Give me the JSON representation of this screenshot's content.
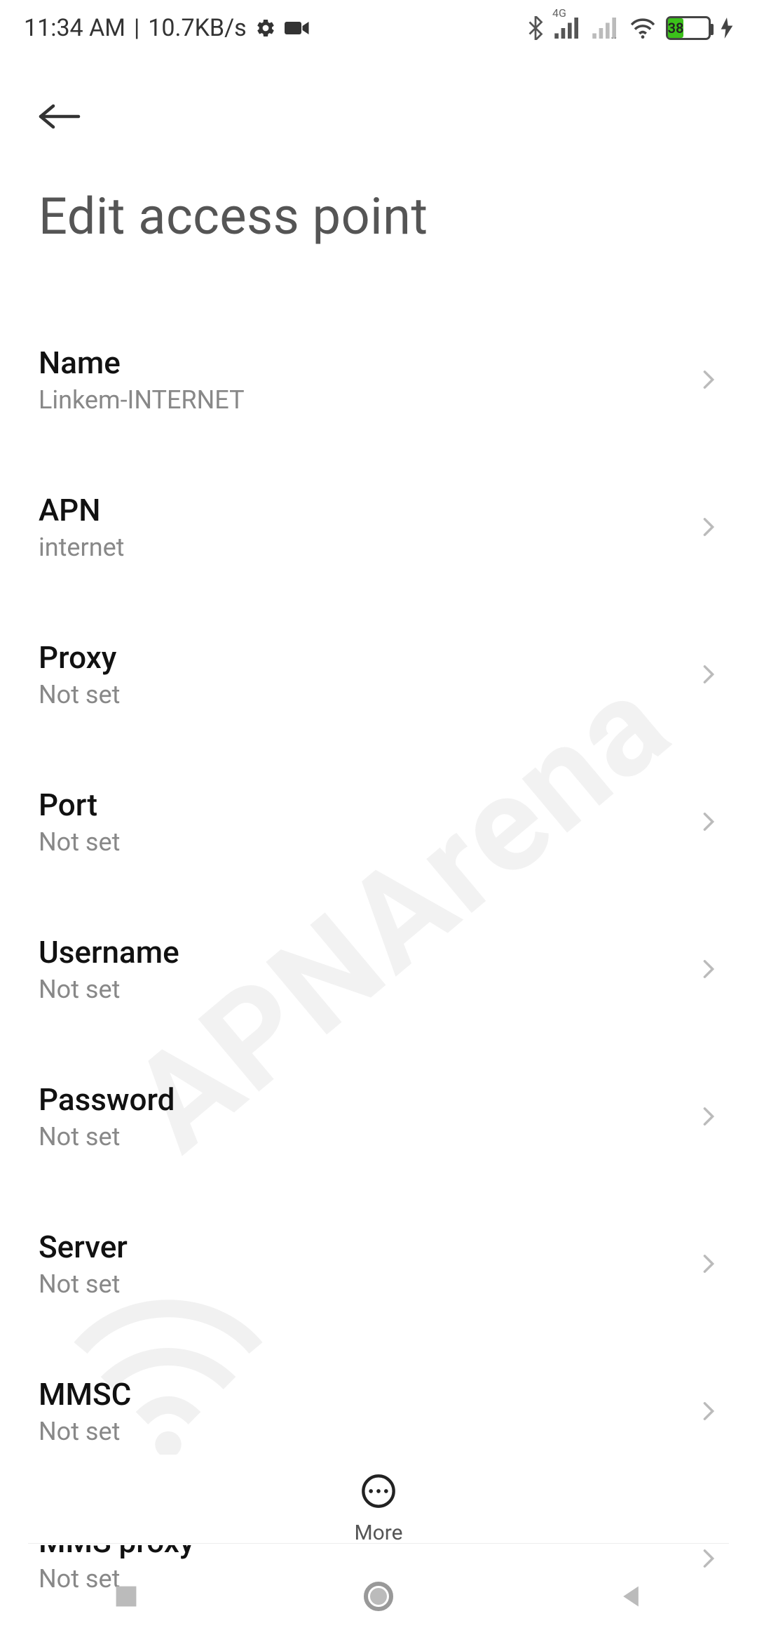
{
  "status_bar": {
    "time": "11:34 AM",
    "separator": "|",
    "speed": "10.7KB/s",
    "battery_percent": "38",
    "network_label": "4G"
  },
  "app_bar": {},
  "page": {
    "title": "Edit access point"
  },
  "settings": [
    {
      "label": "Name",
      "value": "Linkem-INTERNET"
    },
    {
      "label": "APN",
      "value": "internet"
    },
    {
      "label": "Proxy",
      "value": "Not set"
    },
    {
      "label": "Port",
      "value": "Not set"
    },
    {
      "label": "Username",
      "value": "Not set"
    },
    {
      "label": "Password",
      "value": "Not set"
    },
    {
      "label": "Server",
      "value": "Not set"
    },
    {
      "label": "MMSC",
      "value": "Not set"
    },
    {
      "label": "MMS proxy",
      "value": "Not set"
    }
  ],
  "bottom": {
    "more_label": "More"
  },
  "watermark": {
    "text": "APNArena"
  }
}
